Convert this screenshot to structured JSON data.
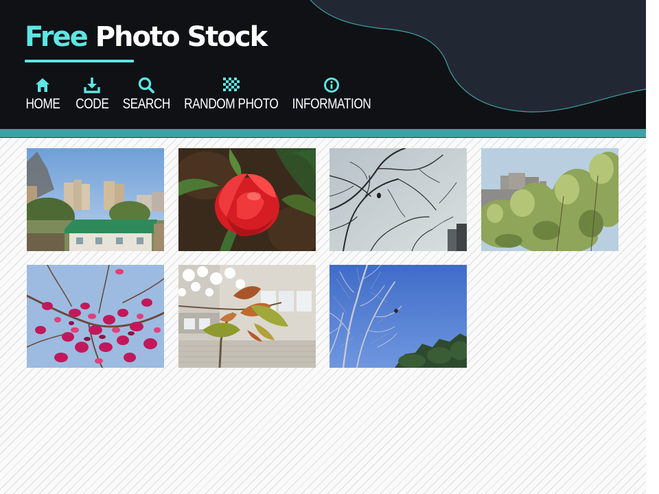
{
  "site": {
    "title_part1": "Free",
    "title_part2": "Photo Stock"
  },
  "nav": [
    {
      "label": "HOME",
      "icon": "home-icon"
    },
    {
      "label": "CODE",
      "icon": "download-icon"
    },
    {
      "label": "SEARCH",
      "icon": "search-icon"
    },
    {
      "label": "RANDOM PHOTO",
      "icon": "random-icon"
    },
    {
      "label": "INFORMATION",
      "icon": "info-icon"
    }
  ],
  "colors": {
    "header_bg": "#0f1115",
    "accent": "#5ce6e4",
    "bar": "#3fa1a3",
    "wave": "#222833"
  },
  "gallery": [
    {
      "subject": "city-buildings-green-roof"
    },
    {
      "subject": "red-tulip"
    },
    {
      "subject": "bare-tree-branches-grey-sky"
    },
    {
      "subject": "green-trees-building"
    },
    {
      "subject": "pink-blossom-buds"
    },
    {
      "subject": "cherry-leaves-building"
    },
    {
      "subject": "bare-tree-blue-sky"
    }
  ]
}
